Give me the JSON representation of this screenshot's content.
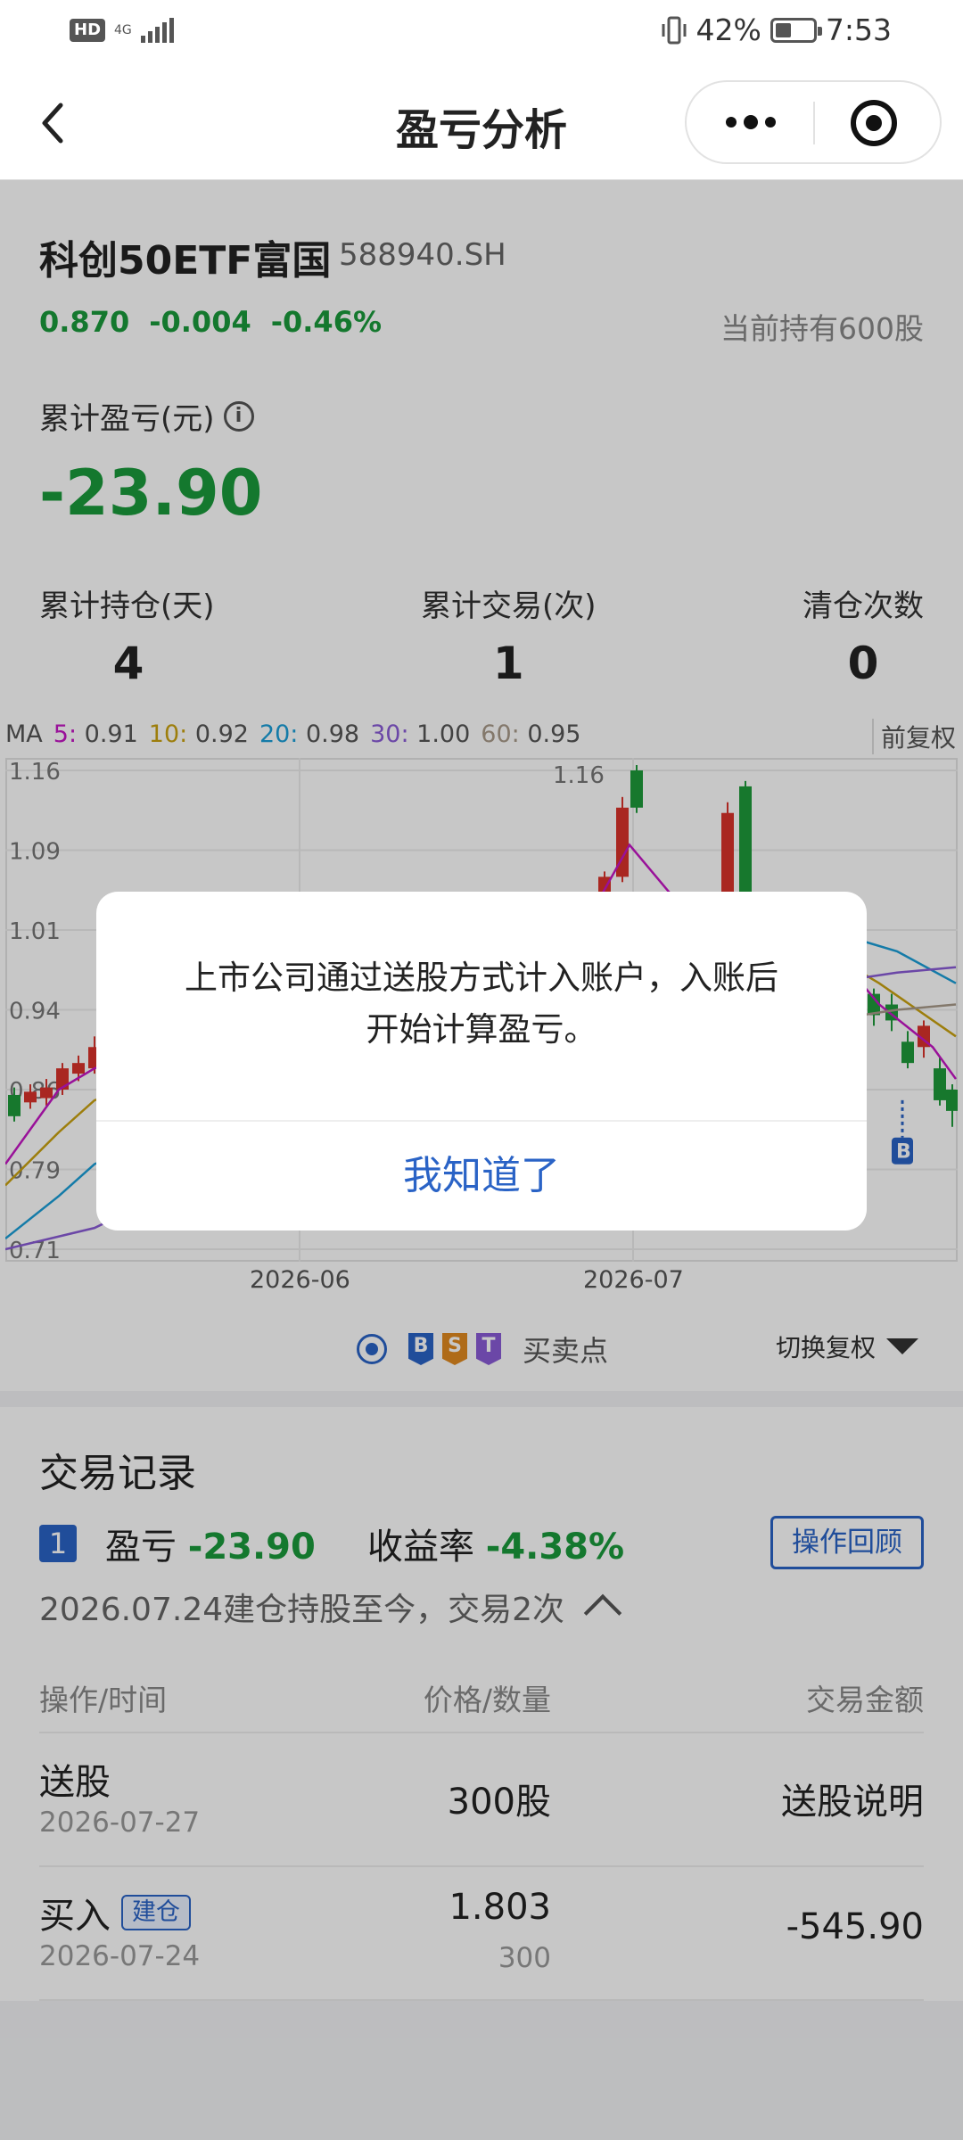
{
  "status": {
    "hd": "HD",
    "network": "4G",
    "battery": "42%",
    "time": "7:53"
  },
  "nav": {
    "title": "盈亏分析",
    "back_icon": "chevron-left-icon",
    "more_icon": "more-dots-icon",
    "close_icon": "target-icon"
  },
  "stock": {
    "name": "科创50ETF富国",
    "code": "588940.SH",
    "price": "0.870",
    "change": "-0.004",
    "change_pct": "-0.46%",
    "holding": "当前持有600股"
  },
  "summary": {
    "cum_label": "累计盈亏(元)",
    "info_icon_text": "i",
    "cum_value": "-23.90",
    "stats": [
      {
        "label": "累计持仓(天)",
        "value": "4"
      },
      {
        "label": "累计交易(次)",
        "value": "1"
      },
      {
        "label": "清仓次数",
        "value": "0"
      }
    ]
  },
  "ma": {
    "prefix": "MA",
    "items": [
      {
        "key": "5:",
        "value": "0.91",
        "color": "#c516c5"
      },
      {
        "key": "10:",
        "value": "0.92",
        "color": "#c9a210"
      },
      {
        "key": "20:",
        "value": "0.98",
        "color": "#1a9ed8"
      },
      {
        "key": "30:",
        "value": "1.00",
        "color": "#8a5bd6"
      },
      {
        "key": "60:",
        "value": "0.95",
        "color": "#a89a8a"
      }
    ],
    "fuquan": "前复权"
  },
  "chart_data": {
    "type": "candlestick",
    "y_ticks": [
      "1.16",
      "1.09",
      "1.01",
      "0.94",
      "0.86",
      "0.79",
      "0.71"
    ],
    "ylim": [
      0.71,
      1.16
    ],
    "x_ticks": [
      "2026-06",
      "2026-07"
    ],
    "max_label": "1.16",
    "marker_label": "B",
    "colors": {
      "up": "#d9322b",
      "down": "#1e9a3a"
    }
  },
  "legend": {
    "markers": [
      {
        "letter": "B",
        "color": "#2a63c6"
      },
      {
        "letter": "S",
        "color": "#e0891f"
      },
      {
        "letter": "T",
        "color": "#8a5bd6"
      }
    ],
    "label": "买卖点",
    "switch_label": "切换复权"
  },
  "records": {
    "title": "交易记录",
    "index": "1",
    "pl_label": "盈亏",
    "pl_value": "-23.90",
    "ret_label": "收益率",
    "ret_value": "-4.38%",
    "review_btn": "操作回顾",
    "desc": "2026.07.24建仓持股至今，交易2次",
    "headers": {
      "op_time": "操作/时间",
      "price_qty": "价格/数量",
      "amount": "交易金额"
    },
    "rows": [
      {
        "op": "送股",
        "date": "2026-07-27",
        "price": "300股",
        "qty": "",
        "amount": "送股说明",
        "tag": ""
      },
      {
        "op": "买入",
        "date": "2026-07-24",
        "price": "1.803",
        "qty": "300",
        "amount": "-545.90",
        "tag": "建仓"
      }
    ]
  },
  "dialog": {
    "message_line1": "上市公司通过送股方式计入账户，入账后",
    "message_line2": "开始计算盈亏。",
    "button": "我知道了"
  }
}
